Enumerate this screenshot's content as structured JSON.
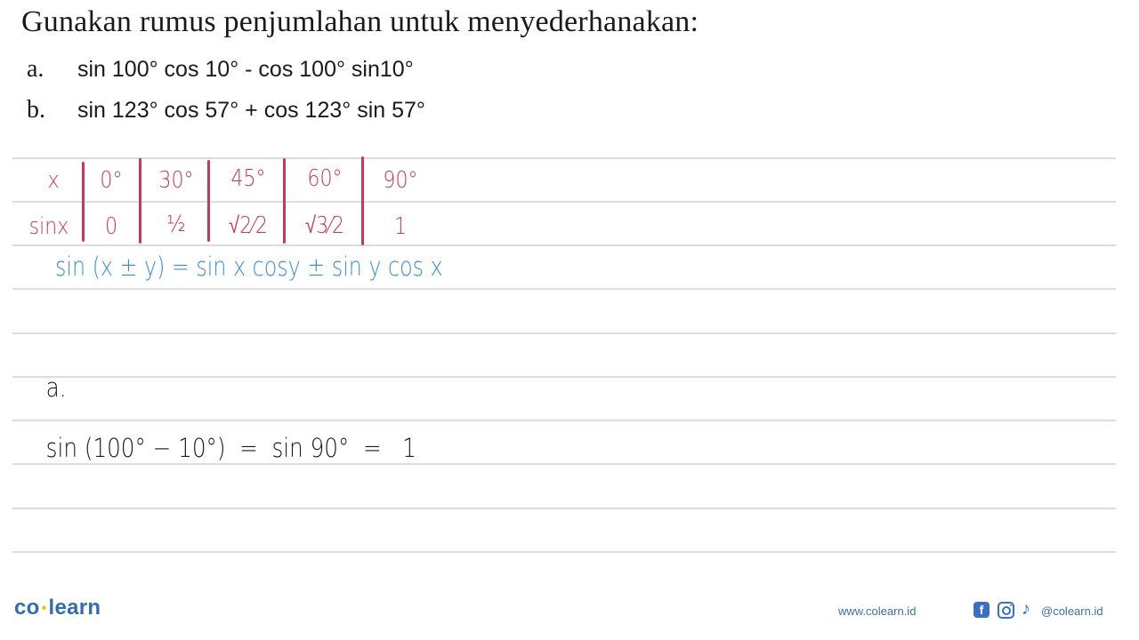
{
  "problem": {
    "title": "Gunakan rumus penjumlahan untuk menyederhanakan:",
    "questions": [
      {
        "label": "a.",
        "expression": "sin 100° cos 10° - cos 100° sin10°"
      },
      {
        "label": "b.",
        "expression": "sin 123° cos 57° + cos 123° sin 57°"
      }
    ]
  },
  "sine_table": {
    "header_label": "x",
    "row_label": "sinx",
    "angles": [
      "0°",
      "30°",
      "45°",
      "60°",
      "90°"
    ],
    "values": [
      "0",
      "½",
      "√2⁄2",
      "√3⁄2",
      "1"
    ]
  },
  "formula": "sin (x ± y) = sin x cosy ± sin y cos x",
  "solution": {
    "label": "a.",
    "work": "sin (100° − 10°)  =  sin 90°  =   1"
  },
  "footer": {
    "brand_left": "co",
    "brand_right": "learn",
    "website": "www.colearn.id",
    "social_handle": "@colearn.id",
    "icons": [
      "facebook-icon",
      "instagram-icon",
      "tiktok-icon"
    ]
  },
  "colors": {
    "table_ink": "#c8385c",
    "formula_ink": "#3a8fd0",
    "brand": "#2f6db5",
    "brand_dot": "#f2c400"
  }
}
